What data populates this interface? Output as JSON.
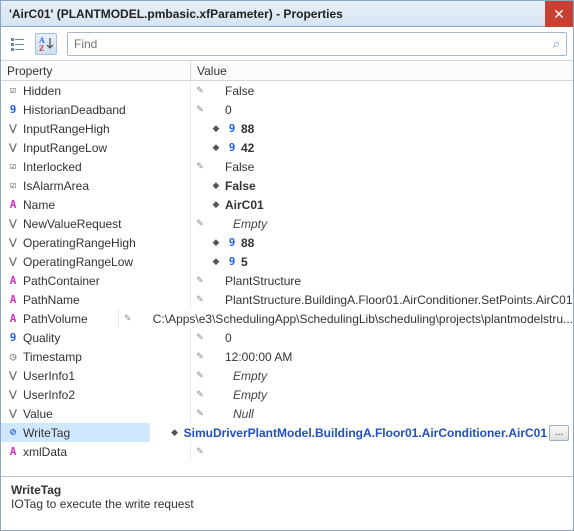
{
  "window": {
    "title": "'AirC01' (PLANTMODEL.pmbasic.xfParameter) - Properties",
    "close_glyph": "✕"
  },
  "toolbar": {
    "categorized_name": "categorized-view-button",
    "alpha_name": "alpha-sort-button"
  },
  "search": {
    "placeholder": "Find",
    "icon_glyph": "⌕"
  },
  "headers": {
    "property": "Property",
    "value": "Value"
  },
  "rows": [
    {
      "icon": "check",
      "name": "Hidden",
      "vedit": "pencil",
      "vmark": "",
      "vtypeico": "",
      "value": "False",
      "cls": ""
    },
    {
      "icon": "digit9",
      "name": "HistorianDeadband",
      "vedit": "pencil",
      "vmark": "",
      "vtypeico": "",
      "value": "0",
      "cls": ""
    },
    {
      "icon": "drop",
      "name": "InputRangeHigh",
      "vedit": "",
      "vmark": "diamond",
      "vtypeico": "9",
      "value": "88",
      "cls": "bold"
    },
    {
      "icon": "drop",
      "name": "InputRangeLow",
      "vedit": "",
      "vmark": "diamond",
      "vtypeico": "9",
      "value": "42",
      "cls": "bold"
    },
    {
      "icon": "check",
      "name": "Interlocked",
      "vedit": "pencil",
      "vmark": "",
      "vtypeico": "",
      "value": "False",
      "cls": ""
    },
    {
      "icon": "check",
      "name": "IsAlarmArea",
      "vedit": "",
      "vmark": "diamond",
      "vtypeico": "",
      "value": "False",
      "cls": "bold"
    },
    {
      "icon": "letterA",
      "name": "Name",
      "vedit": "",
      "vmark": "diamond",
      "vtypeico": "",
      "value": "AirC01",
      "cls": "bold"
    },
    {
      "icon": "drop",
      "name": "NewValueRequest",
      "vedit": "pencil",
      "vmark": "",
      "vtypeico": "",
      "value": "Empty",
      "cls": "italic"
    },
    {
      "icon": "drop",
      "name": "OperatingRangeHigh",
      "vedit": "",
      "vmark": "diamond",
      "vtypeico": "9",
      "value": "88",
      "cls": "bold"
    },
    {
      "icon": "drop",
      "name": "OperatingRangeLow",
      "vedit": "",
      "vmark": "diamond",
      "vtypeico": "9",
      "value": "5",
      "cls": "bold"
    },
    {
      "icon": "letterA",
      "name": "PathContainer",
      "vedit": "pencil",
      "vmark": "",
      "vtypeico": "",
      "value": "PlantStructure",
      "cls": ""
    },
    {
      "icon": "letterA",
      "name": "PathName",
      "vedit": "pencil",
      "vmark": "",
      "vtypeico": "",
      "value": "PlantStructure.BuildingA.Floor01.AirConditioner.SetPoints.AirC01",
      "cls": ""
    },
    {
      "icon": "letterA",
      "name": "PathVolume",
      "vedit": "pencil",
      "vmark": "",
      "vtypeico": "",
      "value": "C:\\Apps\\e3\\SchedulingApp\\SchedulingLib\\scheduling\\projects\\plantmodelstru...",
      "cls": ""
    },
    {
      "icon": "digit9",
      "name": "Quality",
      "vedit": "pencil",
      "vmark": "",
      "vtypeico": "",
      "value": "0",
      "cls": ""
    },
    {
      "icon": "clock",
      "name": "Timestamp",
      "vedit": "pencil",
      "vmark": "",
      "vtypeico": "",
      "value": "12:00:00 AM",
      "cls": ""
    },
    {
      "icon": "drop",
      "name": "UserInfo1",
      "vedit": "pencil",
      "vmark": "",
      "vtypeico": "",
      "value": "Empty",
      "cls": "italic"
    },
    {
      "icon": "drop",
      "name": "UserInfo2",
      "vedit": "pencil",
      "vmark": "",
      "vtypeico": "",
      "value": "Empty",
      "cls": "italic"
    },
    {
      "icon": "drop",
      "name": "Value",
      "vedit": "pencil",
      "vmark": "",
      "vtypeico": "",
      "value": "Null",
      "cls": "italic"
    },
    {
      "icon": "link",
      "name": "WriteTag",
      "vedit": "",
      "vmark": "diamond",
      "vtypeico": "",
      "value": "SimuDriverPlantModel.BuildingA.Floor01.AirConditioner.AirC01",
      "cls": "link",
      "selected": true,
      "ellipsis": true
    },
    {
      "icon": "letterA",
      "name": "xmlData",
      "vedit": "pencil",
      "vmark": "",
      "vtypeico": "",
      "value": "",
      "cls": ""
    }
  ],
  "description": {
    "name": "WriteTag",
    "text": "IOTag to execute the write request"
  },
  "glyphs": {
    "digit9": "9",
    "letterA": "A",
    "drop": "⋁",
    "check": "☑",
    "link": "⊘",
    "clock": "◷",
    "pencil": "✎",
    "diamond": "◆",
    "ellipsis": "..."
  }
}
